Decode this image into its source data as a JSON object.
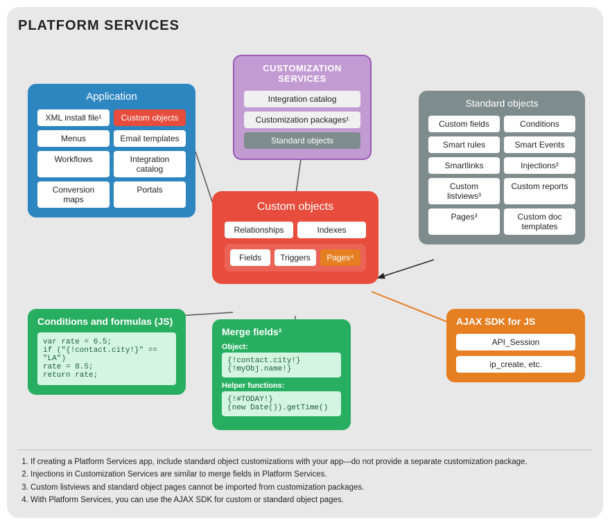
{
  "title": "PLATFORM SERVICES",
  "application": {
    "title": "Application",
    "items": [
      {
        "label": "XML install file¹",
        "style": "white"
      },
      {
        "label": "Custom objects",
        "style": "red"
      },
      {
        "label": "Menus",
        "style": "white"
      },
      {
        "label": "Email templates",
        "style": "white"
      },
      {
        "label": "Workflows",
        "style": "white"
      },
      {
        "label": "Integration catalog",
        "style": "white"
      },
      {
        "label": "Conversion maps",
        "style": "white"
      },
      {
        "label": "Portals",
        "style": "white"
      }
    ]
  },
  "customization": {
    "title": "CUSTOMIZATION SERVICES",
    "items": [
      {
        "label": "Integration catalog",
        "style": "light"
      },
      {
        "label": "Customization packages¹",
        "style": "light"
      },
      {
        "label": "Standard objects",
        "style": "gray"
      }
    ]
  },
  "standard": {
    "title": "Standard objects",
    "items": [
      {
        "label": "Custom fields"
      },
      {
        "label": "Conditions"
      },
      {
        "label": "Smart rules"
      },
      {
        "label": "Smart Events"
      },
      {
        "label": "Smartlinks"
      },
      {
        "label": "Injections²"
      },
      {
        "label": "Custom listviews³"
      },
      {
        "label": "Custom reports"
      },
      {
        "label": "Pages³"
      },
      {
        "label": "Custom doc templates"
      }
    ]
  },
  "customObjects": {
    "title": "Custom objects",
    "row1": [
      {
        "label": "Relationships"
      },
      {
        "label": "Indexes"
      }
    ],
    "row2": [
      {
        "label": "Fields",
        "style": "white"
      },
      {
        "label": "Triggers",
        "style": "white"
      },
      {
        "label": "Pages⁴",
        "style": "orange"
      }
    ]
  },
  "conditions": {
    "title": "Conditions and formulas (JS)",
    "code": "var rate = 6.5;\nif (\"{!contact.city!}\" == \"LA\")\nrate = 8.5;\nreturn rate;"
  },
  "mergeFields": {
    "title": "Merge fields²",
    "objectLabel": "Object:",
    "objectCode": "{!contact.city!}\n{!myObj.name!}",
    "helperLabel": "Helper functions:",
    "helperCode": "{!#TODAY!}\n(new Date()).getTime()"
  },
  "ajax": {
    "title": "AJAX SDK for JS",
    "items": [
      {
        "label": "API_Session"
      },
      {
        "label": "ip_create, etc."
      }
    ]
  },
  "footnotes": [
    "If creating a Platform Services app, include standard object customizations with your app—do not provide a separate customization package.",
    "Injections in Customization Services are similar to merge fields in Platform Services.",
    "Custom listviews and standard object pages cannot be imported from customization packages.",
    "With Platform Services, you can use the AJAX SDK for custom or standard object pages."
  ]
}
